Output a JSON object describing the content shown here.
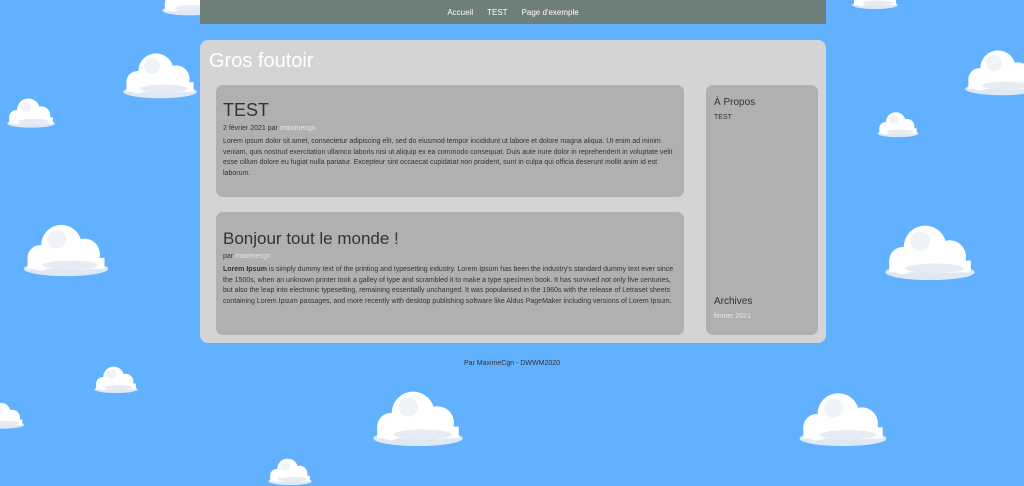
{
  "nav": {
    "items": [
      "Accueil",
      "TEST",
      "Page d'exemple"
    ]
  },
  "site": {
    "title": "Gros foutoir"
  },
  "posts": [
    {
      "title": "TEST",
      "date": "2 février 2021",
      "by": "par",
      "author": "maximecgn",
      "excerpt": "Lorem ipsum dolor sit amet, consectetur adipiscing elit, sed do eiusmod tempor incididunt ut labore et dolore magna aliqua. Ut enim ad minim veniam, quis nostrud exercitation ullamco laboris nisi ut aliquip ex ea commodo consequat. Duis aute irure dolor in reprehenderit in voluptate velit esse cillum dolore eu fugiat nulla pariatur. Excepteur sint occaecat cupidatat non proident, sunt in culpa qui officia deserunt mollit anim id est laborum."
    },
    {
      "title": "Bonjour tout le monde !",
      "by": "par",
      "author": "maximecgn",
      "excerpt_bold": "Lorem Ipsum",
      "excerpt": " is simply dummy text of the printing and typesetting industry. Lorem Ipsum has been the industry's standard dummy text ever since the 1500s, when an unknown printer took a galley of type and scrambled it to make a type specimen book. It has survived not only five centuries, but also the leap into electronic typesetting, remaining essentially unchanged. It was popularised in the 1960s with the release of Letraset sheets containing Lorem Ipsum passages, and more recently with desktop publishing software like Aldus PageMaker including versions of Lorem Ipsum."
    }
  ],
  "sidebar": {
    "about_title": "À Propos",
    "about_text": "TEST",
    "archives_title": "Archives",
    "archives_link": "février 2021"
  },
  "footer": {
    "text": "Par MaximeCgn - DWWM2020"
  },
  "colors": {
    "sky": "#62b1ff",
    "nav": "#6e7e78",
    "panel": "#d4d4d4",
    "card": "#b0b0b0"
  }
}
